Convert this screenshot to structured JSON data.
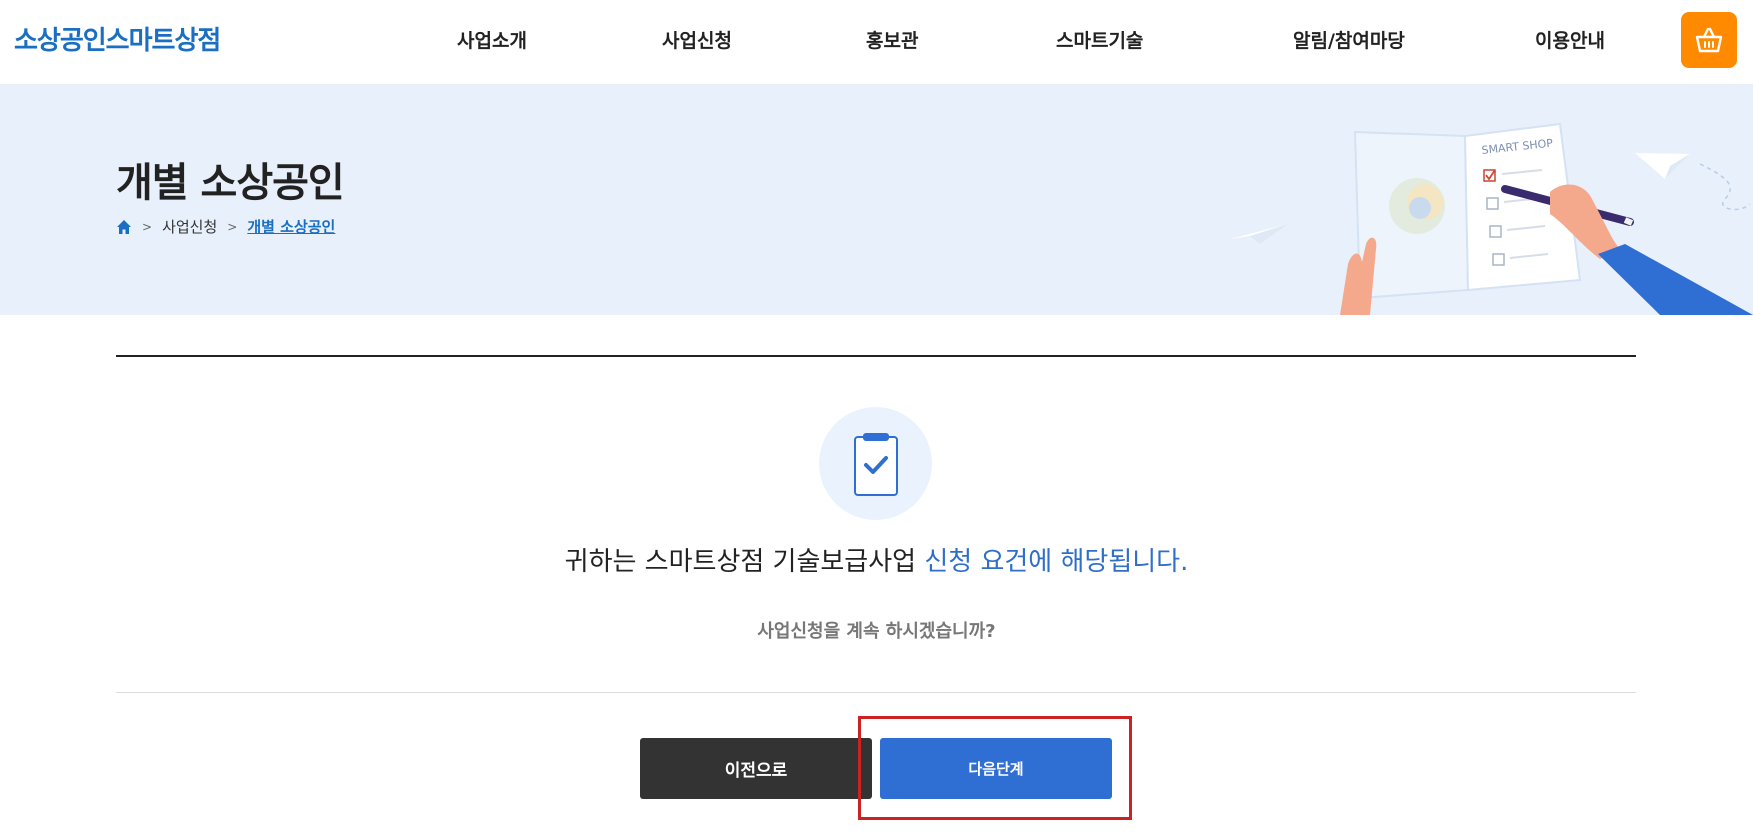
{
  "header": {
    "logo": "소상공인스마트상점",
    "nav": [
      "사업소개",
      "사업신청",
      "홍보관",
      "스마트기술",
      "알림/참여마당",
      "이용안내"
    ],
    "cart_icon": "shopping-basket-icon",
    "cart_color": "#ff8a00"
  },
  "banner": {
    "title": "개별 소상공인",
    "breadcrumb": {
      "home_icon": "home-icon",
      "items": [
        "사업신청",
        "개별 소상공인"
      ]
    },
    "illustration_text": "SMART SHOP",
    "background": "#e8f0fc"
  },
  "content": {
    "icon": "clipboard-check-icon",
    "message_prefix": "귀하는 스마트상점 기술보급사업 ",
    "message_highlight": "신청 요건에 해당됩니다.",
    "question": "사업신청을 계속 하시겠습니까?"
  },
  "buttons": {
    "prev_label": "이전으로",
    "next_label": "다음단계"
  },
  "colors": {
    "accent": "#2f6fd3",
    "brand": "#1a6fc2",
    "highlight_box": "#cc2222"
  }
}
